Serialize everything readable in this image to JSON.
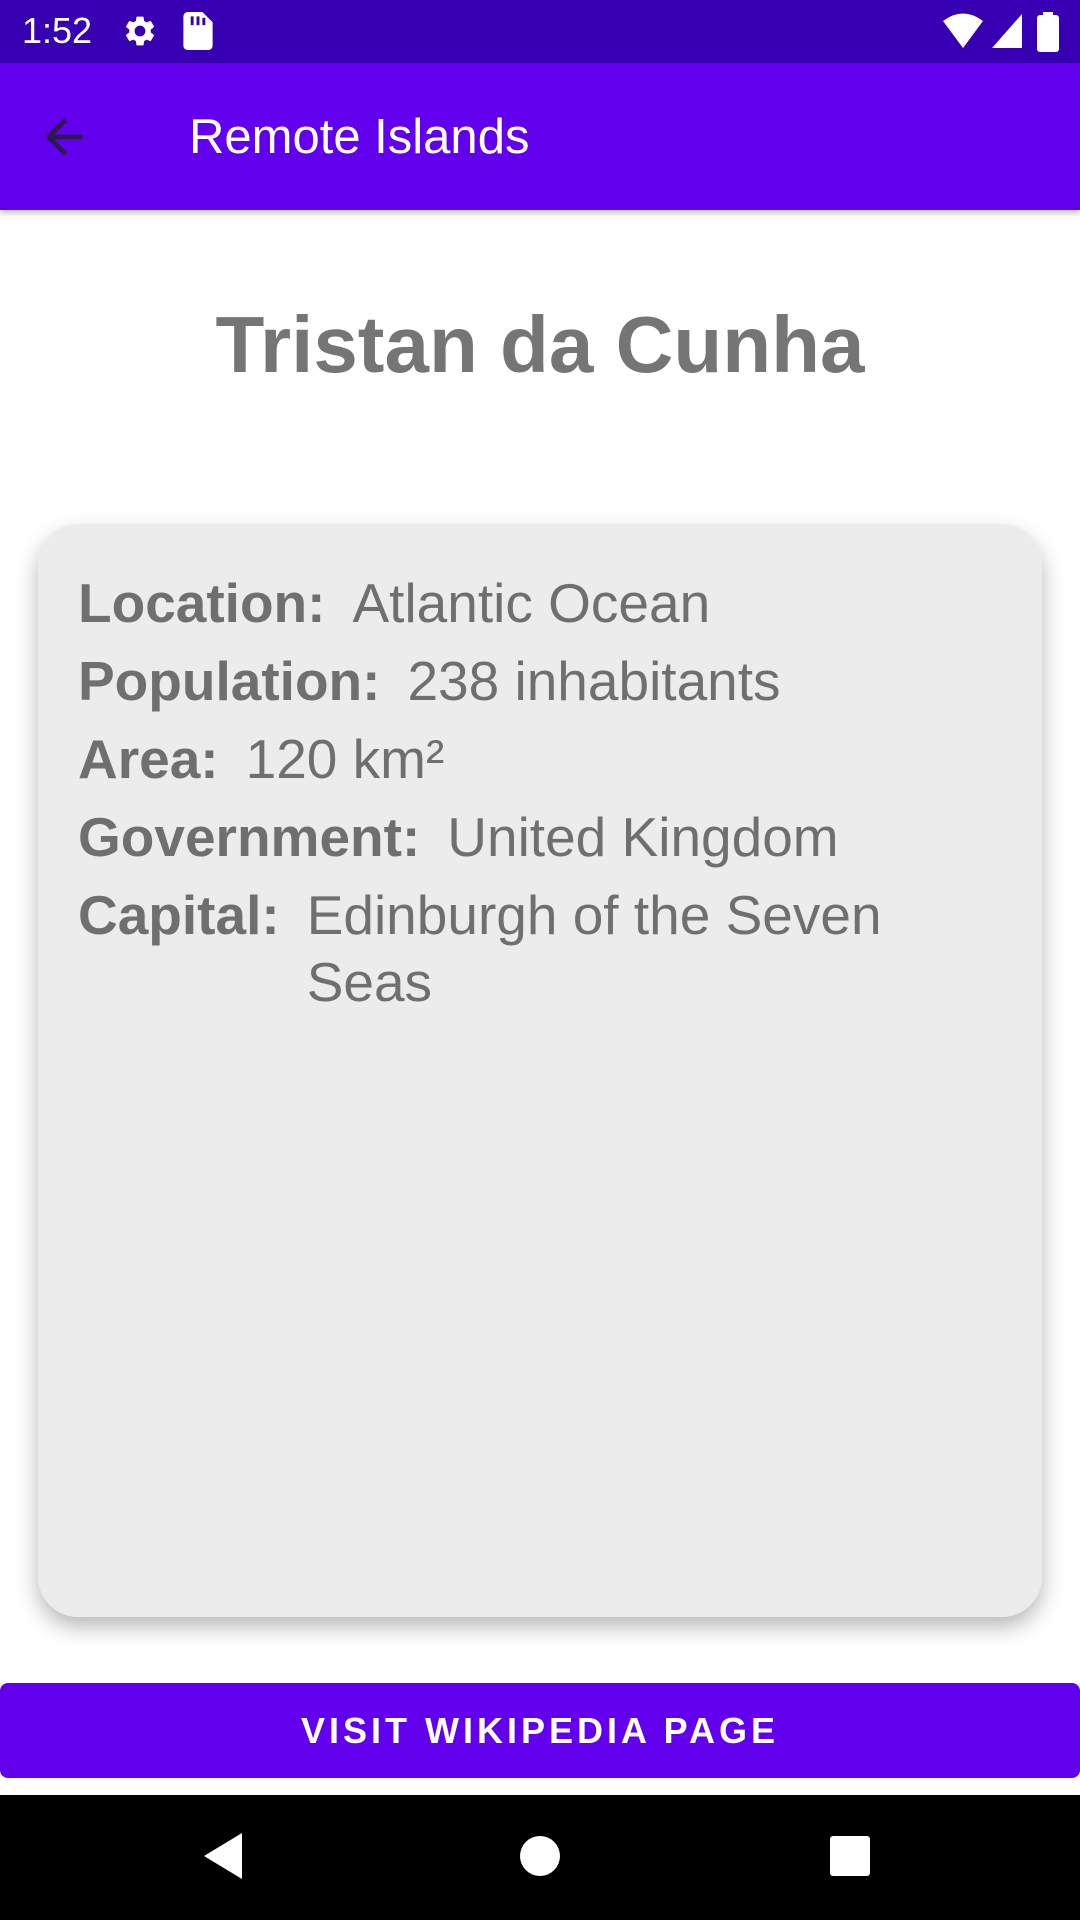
{
  "status_bar": {
    "time": "1:52",
    "icons": [
      "gear-icon",
      "sd-card-icon",
      "wifi-icon",
      "signal-icon",
      "battery-icon"
    ],
    "background": "#3700B3"
  },
  "app_bar": {
    "title": "Remote Islands",
    "back_icon": "arrow-back-icon",
    "background": "#6200EE"
  },
  "island": {
    "name": "Tristan da Cunha",
    "details": [
      {
        "label": "Location:",
        "value": "Atlantic Ocean"
      },
      {
        "label": "Population:",
        "value": "238 inhabitants"
      },
      {
        "label": "Area:",
        "value": "120 km²"
      },
      {
        "label": "Government:",
        "value": "United Kingdom"
      },
      {
        "label": "Capital:",
        "value": "Edinburgh of the Seven Seas"
      }
    ]
  },
  "wiki_button": {
    "label": "VISIT WIKIPEDIA PAGE"
  },
  "nav_bar": {
    "icons": [
      "nav-back-icon",
      "nav-home-icon",
      "nav-recents-icon"
    ]
  }
}
